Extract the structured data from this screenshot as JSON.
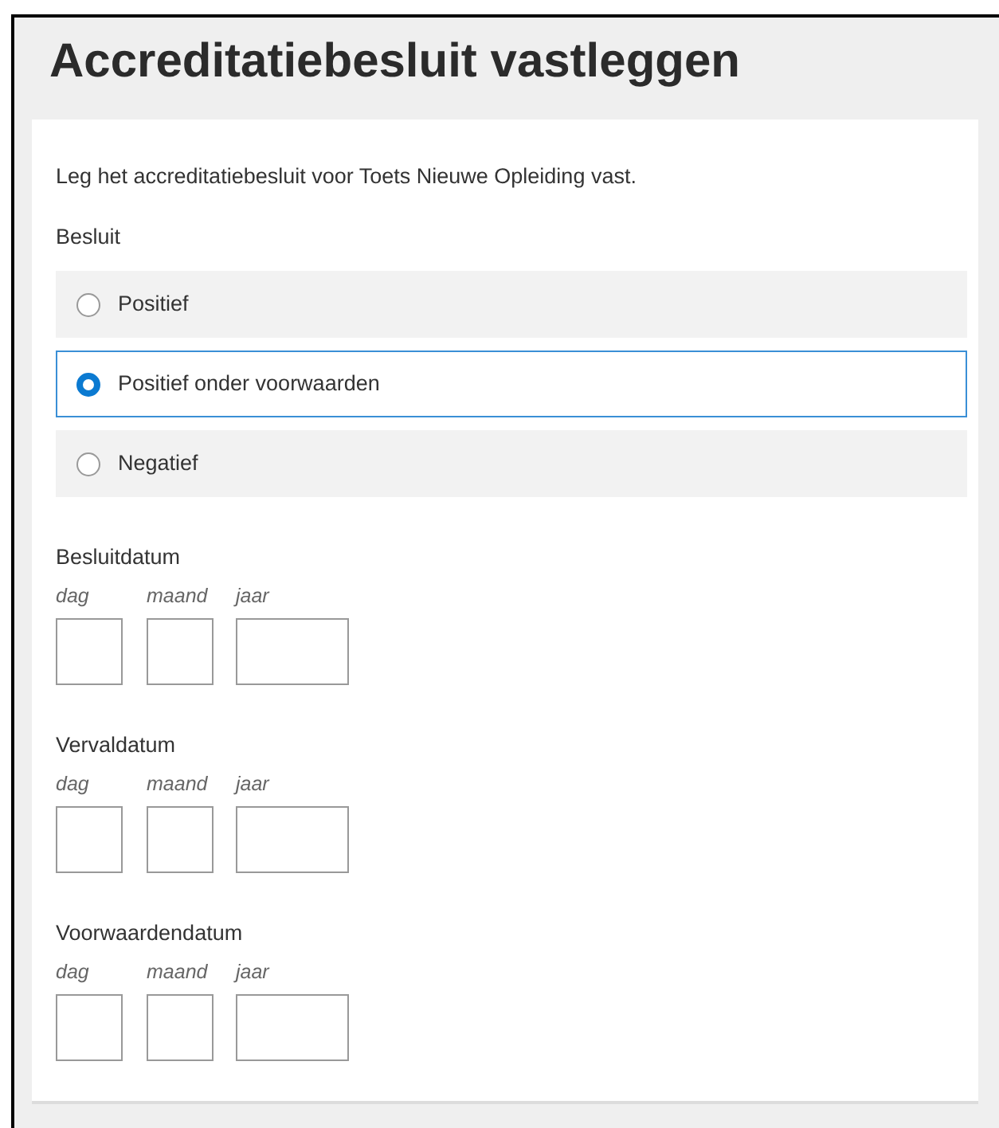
{
  "title": "Accreditatiebesluit vastleggen",
  "intro": "Leg het accreditatiebesluit voor Toets Nieuwe Opleiding vast.",
  "decision": {
    "label": "Besluit",
    "options": [
      {
        "label": "Positief",
        "selected": false
      },
      {
        "label": "Positief onder voorwaarden",
        "selected": true
      },
      {
        "label": "Negatief",
        "selected": false
      }
    ]
  },
  "date_fields": [
    {
      "label": "Besluitdatum",
      "parts": [
        "dag",
        "maand",
        "jaar"
      ]
    },
    {
      "label": "Vervaldatum",
      "parts": [
        "dag",
        "maand",
        "jaar"
      ]
    },
    {
      "label": "Voorwaardendatum",
      "parts": [
        "dag",
        "maand",
        "jaar"
      ]
    }
  ]
}
